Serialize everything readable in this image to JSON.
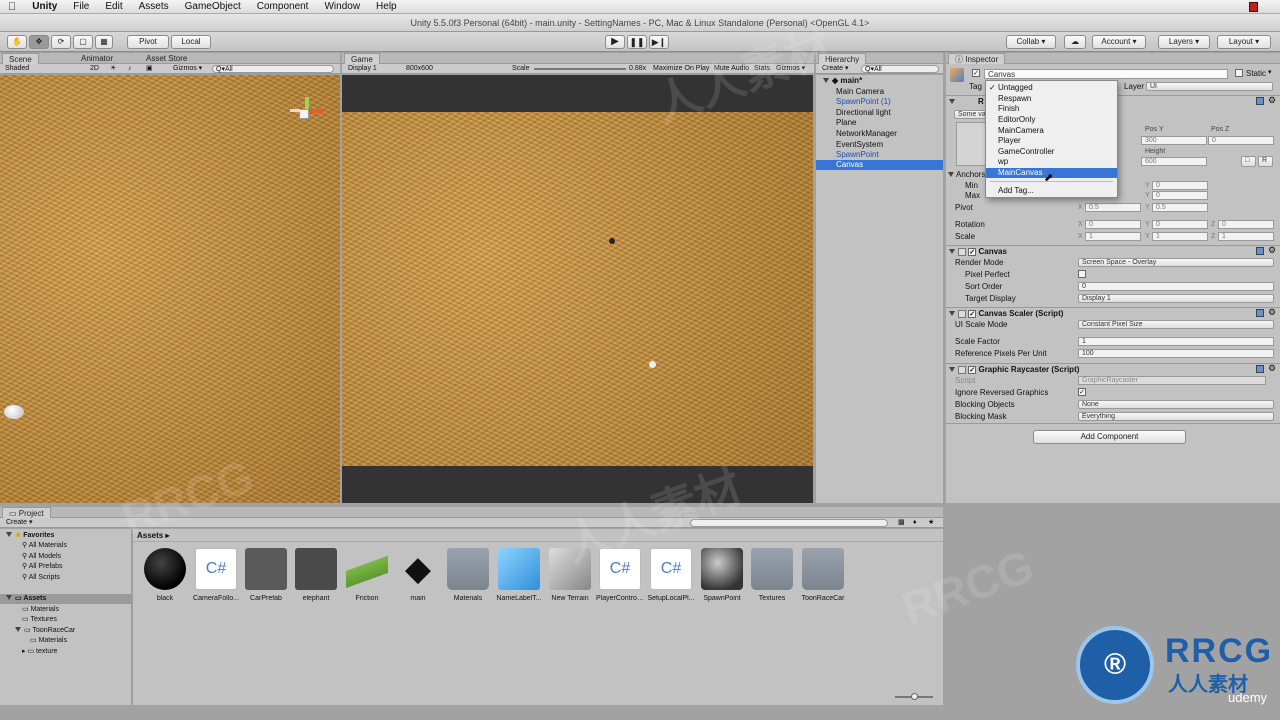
{
  "menubar": {
    "app": "Unity",
    "items": [
      "File",
      "Edit",
      "Assets",
      "GameObject",
      "Component",
      "Window",
      "Help"
    ]
  },
  "title": "Unity 5.5.0f3 Personal (64bit) - main.unity - SettingNames - PC, Mac & Linux Standalone (Personal) <OpenGL 4.1>",
  "toolbar": {
    "pivot": "Pivot",
    "local": "Local",
    "collab": "Collab ▾",
    "account": "Account ▾",
    "layers": "Layers ▾",
    "layout": "Layout ▾"
  },
  "scene": {
    "tabs": [
      "Scene",
      "Animator",
      "Asset Store"
    ],
    "shaded": "Shaded",
    "mode2d": "2D",
    "gizmos": "Gizmos ▾",
    "search": "Q▾All"
  },
  "game": {
    "tab": "Game",
    "display": "Display 1",
    "resolution": "800x600",
    "scale_label": "Scale",
    "scale_value": "0.88x",
    "maximize": "Maximize On Play",
    "mute": "Mute Audio",
    "stats": "Stats",
    "gizmos": "Gizmos ▾"
  },
  "hierarchy": {
    "tab": "Hierarchy",
    "create": "Create ▾",
    "search": "Q▾All",
    "scene": "main*",
    "items": [
      "Main Camera",
      "SpawnPoint (1)",
      "Directional light",
      "Plane",
      "NetworkManager",
      "EventSystem",
      "SpawnPoint",
      "Canvas"
    ],
    "selected_index": 7
  },
  "inspector": {
    "tab": "Inspector",
    "name": "Canvas",
    "static": "Static",
    "tag_label": "Tag",
    "layer_label": "Layer",
    "layer_value": "UI",
    "rect": {
      "head": "R",
      "some_values": "Some val",
      "posy_label": "Pos Y",
      "posz_label": "Pos Z",
      "posy": "300",
      "posz": "0",
      "height_label": "Height",
      "height": "600",
      "anchors": "Anchors",
      "min": "Min",
      "max": "Max",
      "pivot": "Pivot",
      "rotation": "Rotation",
      "scale": "Scale",
      "min_x": "0",
      "min_y": "0",
      "max_x": "0",
      "max_y": "0",
      "pivot_x": "0.5",
      "pivot_y": "0.5",
      "rot_x": "0",
      "rot_y": "0",
      "rot_z": "0",
      "scale_x": "1",
      "scale_y": "1",
      "scale_z": "1",
      "x": "X",
      "y": "Y",
      "z": "Z",
      "btn_r": "R"
    },
    "canvas": {
      "head": "Canvas",
      "render_mode_label": "Render Mode",
      "render_mode": "Screen Space - Overlay",
      "pixel_perfect": "Pixel Perfect",
      "sort_order_label": "Sort Order",
      "sort_order": "0",
      "target_display_label": "Target Display",
      "target_display": "Display 1"
    },
    "scaler": {
      "head": "Canvas Scaler (Script)",
      "ui_scale_label": "UI Scale Mode",
      "ui_scale": "Constant Pixel Size",
      "scale_factor_label": "Scale Factor",
      "scale_factor": "1",
      "ref_ppu_label": "Reference Pixels Per Unit",
      "ref_ppu": "100"
    },
    "raycaster": {
      "head": "Graphic Raycaster (Script)",
      "script_label": "Script",
      "script": "GraphicRaycaster",
      "ignore_label": "Ignore Reversed Graphics",
      "blocking_label": "Blocking Objects",
      "blocking": "None",
      "mask_label": "Blocking Mask",
      "mask": "Everything"
    },
    "add_component": "Add Component"
  },
  "tag_popup": {
    "options": [
      "Untagged",
      "Respawn",
      "Finish",
      "EditorOnly",
      "MainCamera",
      "Player",
      "GameController",
      "wp",
      "MainCanvas"
    ],
    "checked_index": 0,
    "highlight_index": 8,
    "add_tag": "Add Tag..."
  },
  "project": {
    "tab": "Project",
    "create": "Create ▾",
    "favorites": "Favorites",
    "fav_items": [
      "All Materials",
      "All Models",
      "All Prefabs",
      "All Scripts"
    ],
    "assets_root": "Assets",
    "tree": [
      "Materials",
      "Textures",
      "ToonRaceCar",
      "Materials",
      "texture"
    ],
    "breadcrumb": "Assets ▸",
    "assets": [
      {
        "name": "black",
        "type": "material"
      },
      {
        "name": "CameraFollo...",
        "type": "script"
      },
      {
        "name": "CarPrefab",
        "type": "prefab-car"
      },
      {
        "name": "elephant",
        "type": "prefab-dark"
      },
      {
        "name": "Friction",
        "type": "physic"
      },
      {
        "name": "main",
        "type": "unity"
      },
      {
        "name": "Materials",
        "type": "folder"
      },
      {
        "name": "NameLabelT...",
        "type": "cube"
      },
      {
        "name": "New Terrain",
        "type": "terrain"
      },
      {
        "name": "PlayerControl...",
        "type": "script"
      },
      {
        "name": "SetupLocalPl...",
        "type": "script"
      },
      {
        "name": "SpawnPoint",
        "type": "sphere"
      },
      {
        "name": "Textures",
        "type": "folder"
      },
      {
        "name": "ToonRaceCar",
        "type": "folder"
      }
    ]
  },
  "watermark": {
    "logo": "RRCG",
    "cn": "人人素材",
    "site": "udemy"
  },
  "colors": {
    "selection": "#3875d7",
    "panel": "#c2c2c2"
  }
}
